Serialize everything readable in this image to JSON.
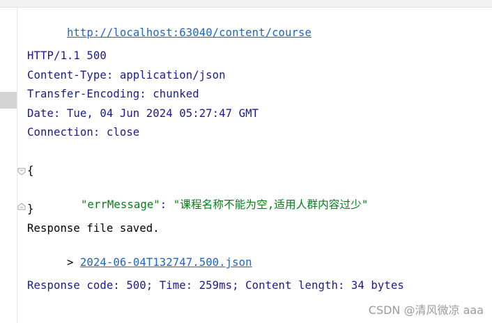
{
  "request": {
    "url": "http://localhost:63040/content/course"
  },
  "response": {
    "status_line": "HTTP/1.1 500",
    "headers": [
      "Content-Type: application/json",
      "Transfer-Encoding: chunked",
      "Date: Tue, 04 Jun 2024 05:27:47 GMT",
      "Connection: close"
    ],
    "body": {
      "open_brace": "{",
      "key": "\"errMessage\"",
      "colon": ": ",
      "value": "\"课程名称不能为空,适用人群内容过少\"",
      "close_brace": "}"
    },
    "saved_text": "Response file saved.",
    "saved_prefix": "> ",
    "saved_file": "2024-06-04T132747.500.json",
    "summary": "Response code: 500; Time: 259ms; Content length: 34 bytes"
  },
  "watermark": "CSDN @清风微凉 aaa",
  "icons": {
    "fold_open": "fold-open-icon",
    "fold_close": "fold-close-icon"
  }
}
